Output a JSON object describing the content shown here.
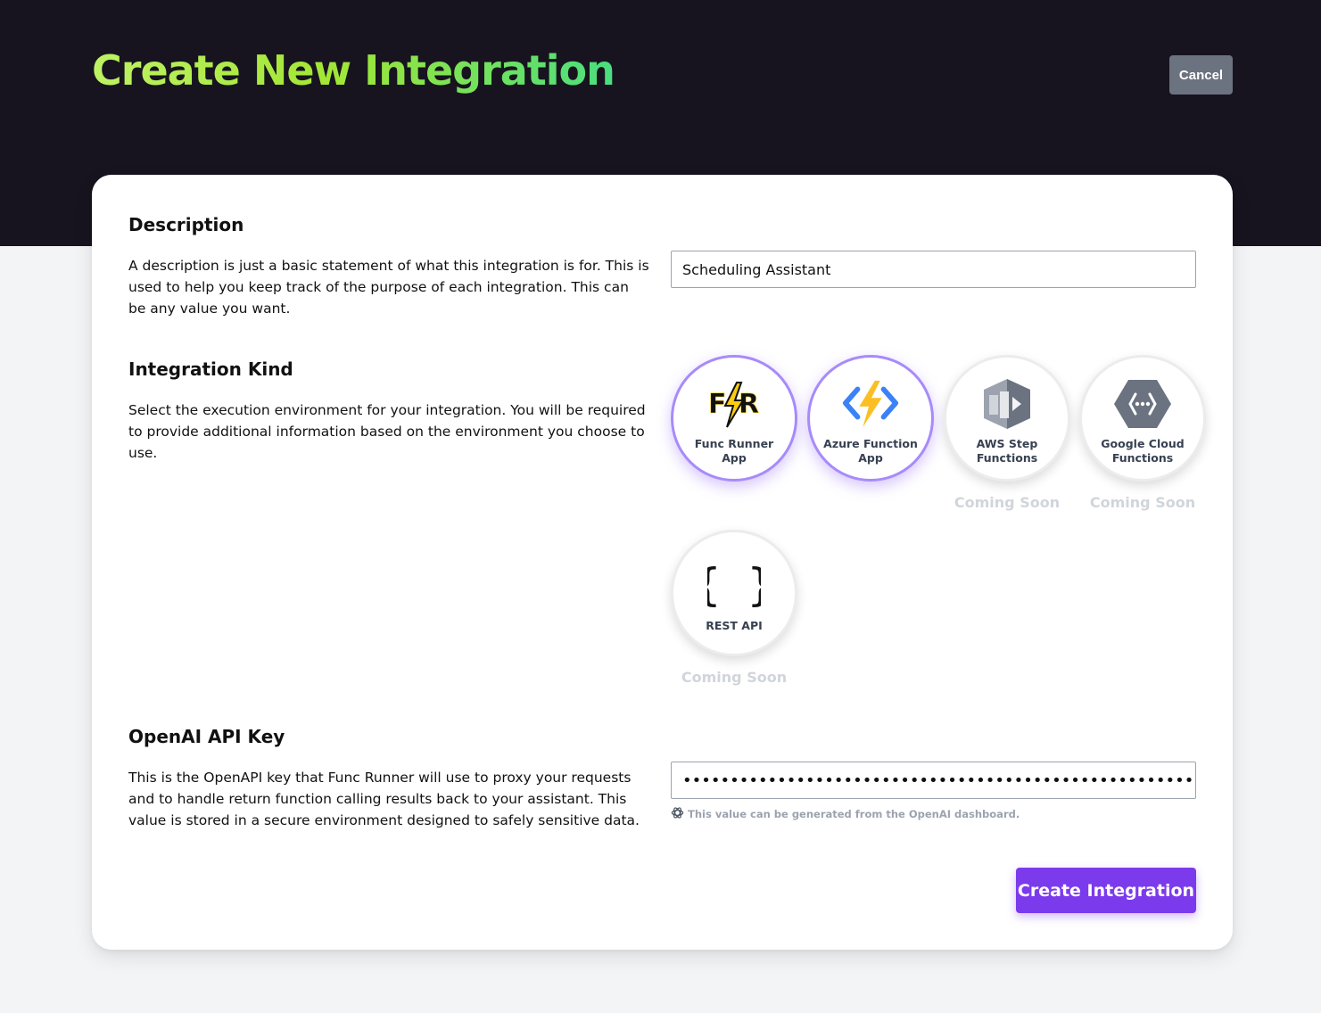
{
  "header": {
    "title": "Create New Integration",
    "cancel_label": "Cancel"
  },
  "description_section": {
    "title": "Description",
    "text": "A description is just a basic statement of what this integration is for. This is used to help you keep track of the purpose of each integration. This can be any value you want.",
    "input_value": "Scheduling Assistant"
  },
  "kind_section": {
    "title": "Integration Kind",
    "text": "Select the execution environment for your integration. You will be required to provide additional information based on the environment you choose to use.",
    "kinds": [
      {
        "label": "Func Runner App",
        "icon": "func-runner-logo-icon",
        "state": "selected",
        "badge": ""
      },
      {
        "label": "Azure Function App",
        "icon": "azure-function-icon",
        "state": "selected",
        "badge": ""
      },
      {
        "label": "AWS Step Functions",
        "icon": "aws-step-functions-icon",
        "state": "disabled",
        "badge": "Coming Soon"
      },
      {
        "label": "Google Cloud Functions",
        "icon": "google-cloud-functions-icon",
        "state": "disabled",
        "badge": "Coming Soon"
      },
      {
        "label": "REST API",
        "icon": "curly-braces-icon",
        "state": "disabled",
        "badge": "Coming Soon"
      }
    ]
  },
  "api_key_section": {
    "title": "OpenAI API Key",
    "text": "This is the OpenAPI key that Func Runner will use to proxy your requests and to handle return function calling results back to your assistant. This value is stored in a secure environment designed to safely sensitive data.",
    "masked_value": "••••••••••••••••••••••••••••••••••••••••••••••••••••••••••••••",
    "hint": "This value can be generated from the OpenAI dashboard."
  },
  "submit_label": "Create Integration",
  "colors": {
    "header_bg": "#17141f",
    "accent": "#7c3aed",
    "selected_ring": "#a78bfa",
    "title_gradient_start": "#bef264",
    "title_gradient_end": "#4ade80"
  }
}
